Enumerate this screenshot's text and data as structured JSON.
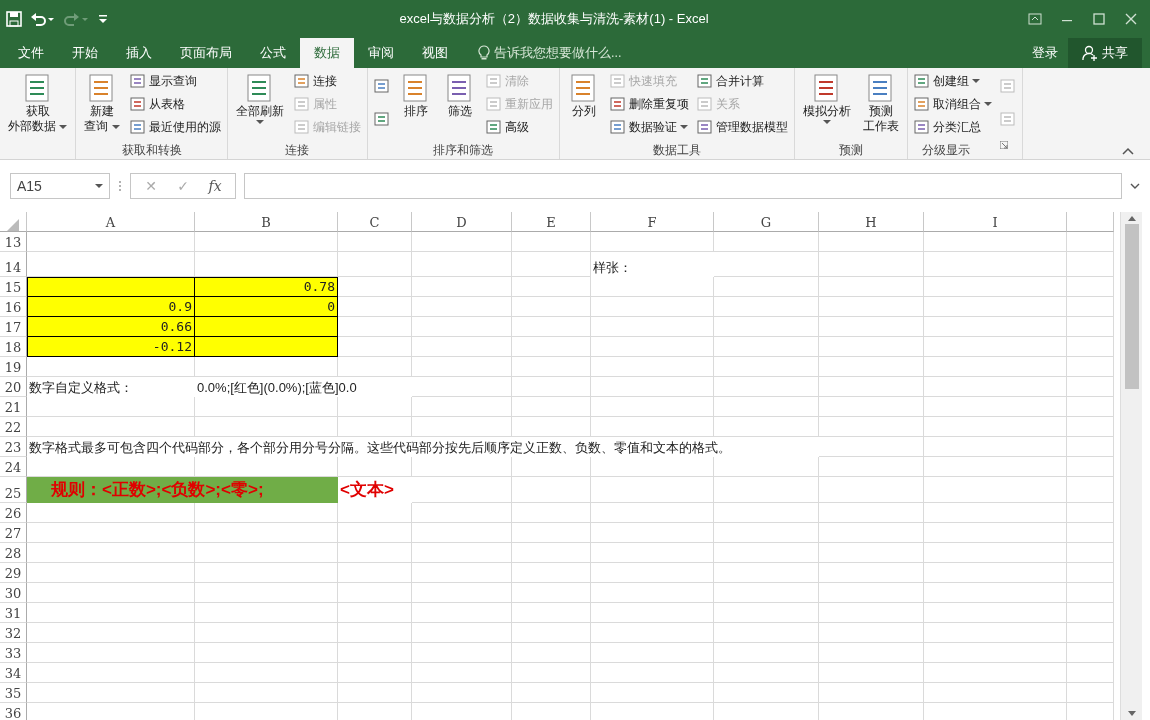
{
  "window": {
    "title": "excel与数据分析（2）数据收集与清洗-素材(1) - Excel"
  },
  "quick_access": {
    "undo_enabled": true,
    "redo_enabled": false
  },
  "tabs": [
    {
      "label": "文件",
      "selected": false
    },
    {
      "label": "开始",
      "selected": false
    },
    {
      "label": "插入",
      "selected": false
    },
    {
      "label": "页面布局",
      "selected": false
    },
    {
      "label": "公式",
      "selected": false
    },
    {
      "label": "数据",
      "selected": true
    },
    {
      "label": "审阅",
      "selected": false
    },
    {
      "label": "视图",
      "selected": false
    }
  ],
  "tell_me": {
    "placeholder": "告诉我您想要做什么..."
  },
  "account": {
    "login": "登录",
    "share": "共享"
  },
  "ribbon_groups": [
    {
      "columns": [
        [
          {
            "kind": "large",
            "lines": [
              "获取",
              "外部数据"
            ],
            "dropdown": true,
            "disabled": false
          }
        ]
      ]
    },
    {
      "label": "获取和转换",
      "columns": [
        [
          {
            "kind": "large",
            "lines": [
              "新建",
              "查询"
            ],
            "dropdown": true,
            "disabled": false
          }
        ],
        [
          {
            "kind": "small",
            "lines": [
              "显示查询"
            ],
            "dropdown": false,
            "disabled": false
          },
          {
            "kind": "small",
            "lines": [
              "从表格"
            ],
            "dropdown": false,
            "disabled": false
          },
          {
            "kind": "small",
            "lines": [
              "最近使用的源"
            ],
            "dropdown": false,
            "disabled": false
          }
        ]
      ]
    },
    {
      "label": "连接",
      "columns": [
        [
          {
            "kind": "large",
            "lines": [
              "全部刷新"
            ],
            "dropdown": true,
            "disabled": false
          }
        ],
        [
          {
            "kind": "small",
            "lines": [
              "连接"
            ],
            "dropdown": false,
            "disabled": false
          },
          {
            "kind": "small",
            "lines": [
              "属性"
            ],
            "dropdown": false,
            "disabled": true
          },
          {
            "kind": "small",
            "lines": [
              "编辑链接"
            ],
            "dropdown": false,
            "disabled": true
          }
        ]
      ]
    },
    {
      "label": "排序和筛选",
      "columns": [
        [
          {
            "kind": "icon",
            "disabled": false
          },
          {
            "kind": "icon",
            "disabled": false
          }
        ],
        [
          {
            "kind": "large",
            "lines": [
              "排序"
            ],
            "dropdown": false,
            "disabled": false
          }
        ],
        [
          {
            "kind": "large",
            "lines": [
              "筛选"
            ],
            "dropdown": false,
            "disabled": false
          }
        ],
        [
          {
            "kind": "small",
            "lines": [
              "清除"
            ],
            "dropdown": false,
            "disabled": true
          },
          {
            "kind": "small",
            "lines": [
              "重新应用"
            ],
            "dropdown": false,
            "disabled": true
          },
          {
            "kind": "small",
            "lines": [
              "高级"
            ],
            "dropdown": false,
            "disabled": false
          }
        ]
      ]
    },
    {
      "label": "数据工具",
      "columns": [
        [
          {
            "kind": "large",
            "lines": [
              "分列"
            ],
            "dropdown": false,
            "disabled": false
          }
        ],
        [
          {
            "kind": "small",
            "lines": [
              "快速填充"
            ],
            "dropdown": false,
            "disabled": true
          },
          {
            "kind": "small",
            "lines": [
              "删除重复项"
            ],
            "dropdown": false,
            "disabled": false
          },
          {
            "kind": "small",
            "lines": [
              "数据验证"
            ],
            "dropdown": true,
            "disabled": false
          }
        ],
        [
          {
            "kind": "small",
            "lines": [
              "合并计算"
            ],
            "dropdown": false,
            "disabled": false
          },
          {
            "kind": "small",
            "lines": [
              "关系"
            ],
            "dropdown": false,
            "disabled": true
          },
          {
            "kind": "small",
            "lines": [
              "管理数据模型"
            ],
            "dropdown": false,
            "disabled": false
          }
        ]
      ]
    },
    {
      "label": "预测",
      "columns": [
        [
          {
            "kind": "large",
            "lines": [
              "模拟分析"
            ],
            "dropdown": true,
            "disabled": false
          }
        ],
        [
          {
            "kind": "large",
            "lines": [
              "预测",
              "工作表"
            ],
            "dropdown": false,
            "disabled": false
          }
        ]
      ]
    },
    {
      "label": "分级显示",
      "launcher": true,
      "columns": [
        [
          {
            "kind": "small",
            "lines": [
              "创建组"
            ],
            "dropdown": true,
            "disabled": false
          },
          {
            "kind": "small",
            "lines": [
              "取消组合"
            ],
            "dropdown": true,
            "disabled": false
          },
          {
            "kind": "small",
            "lines": [
              "分类汇总"
            ],
            "dropdown": false,
            "disabled": false
          }
        ],
        [
          {
            "kind": "icon",
            "disabled": true
          },
          {
            "kind": "icon",
            "disabled": true
          }
        ]
      ]
    }
  ],
  "formula_bar": {
    "name_box": "A15",
    "cancel": "✕",
    "enter": "✓",
    "function": "fx"
  },
  "columns": [
    "A",
    "B",
    "C",
    "D",
    "E",
    "F",
    "G",
    "H",
    "I"
  ],
  "rows": [
    {
      "number": "13",
      "cells": {}
    },
    {
      "number": "14",
      "cells": {
        "F": {
          "kind": "text",
          "text": "样张："
        }
      }
    },
    {
      "number": "15",
      "cells": {
        "A": {
          "kind": "highlight"
        },
        "B": {
          "kind": "highlight",
          "text": "0.78"
        }
      }
    },
    {
      "number": "16",
      "cells": {
        "A": {
          "kind": "highlight",
          "text": "0.9"
        },
        "B": {
          "kind": "highlight",
          "text": "0"
        }
      }
    },
    {
      "number": "17",
      "cells": {
        "A": {
          "kind": "highlight",
          "text": "0.66"
        },
        "B": {
          "kind": "highlight"
        }
      }
    },
    {
      "number": "18",
      "cells": {
        "A": {
          "kind": "highlight",
          "text": "-0.12"
        },
        "B": {
          "kind": "highlight"
        }
      }
    },
    {
      "number": "19",
      "cells": {}
    },
    {
      "number": "20",
      "cells": {
        "A": {
          "kind": "text",
          "text": "数字自定义格式："
        },
        "B": {
          "kind": "text",
          "text": "0.0%;[红色](0.0%);[蓝色]0.0"
        }
      }
    },
    {
      "number": "21",
      "cells": {}
    },
    {
      "number": "22",
      "cells": {}
    },
    {
      "number": "23",
      "cells": {
        "A": {
          "kind": "text",
          "text": "数字格式最多可包含四个代码部分，各个部分用分号分隔。这些代码部分按先后顺序定义正数、负数、零值和文本的格式。"
        }
      }
    },
    {
      "number": "24",
      "cells": {}
    },
    {
      "number": "25",
      "cells": {
        "A": {
          "kind": "rule",
          "text": "规则：<正数>;<负数>;<零>;"
        },
        "B": {
          "kind": "rule"
        },
        "C": {
          "kind": "rule-tail",
          "text": "<文本>"
        }
      }
    },
    {
      "number": "26",
      "cells": {}
    },
    {
      "number": "27",
      "cells": {}
    },
    {
      "number": "28",
      "cells": {}
    },
    {
      "number": "29",
      "cells": {}
    },
    {
      "number": "30",
      "cells": {}
    },
    {
      "number": "31",
      "cells": {}
    },
    {
      "number": "32",
      "cells": {}
    },
    {
      "number": "33",
      "cells": {}
    },
    {
      "number": "34",
      "cells": {}
    },
    {
      "number": "35",
      "cells": {}
    },
    {
      "number": "36",
      "cells": {}
    }
  ]
}
